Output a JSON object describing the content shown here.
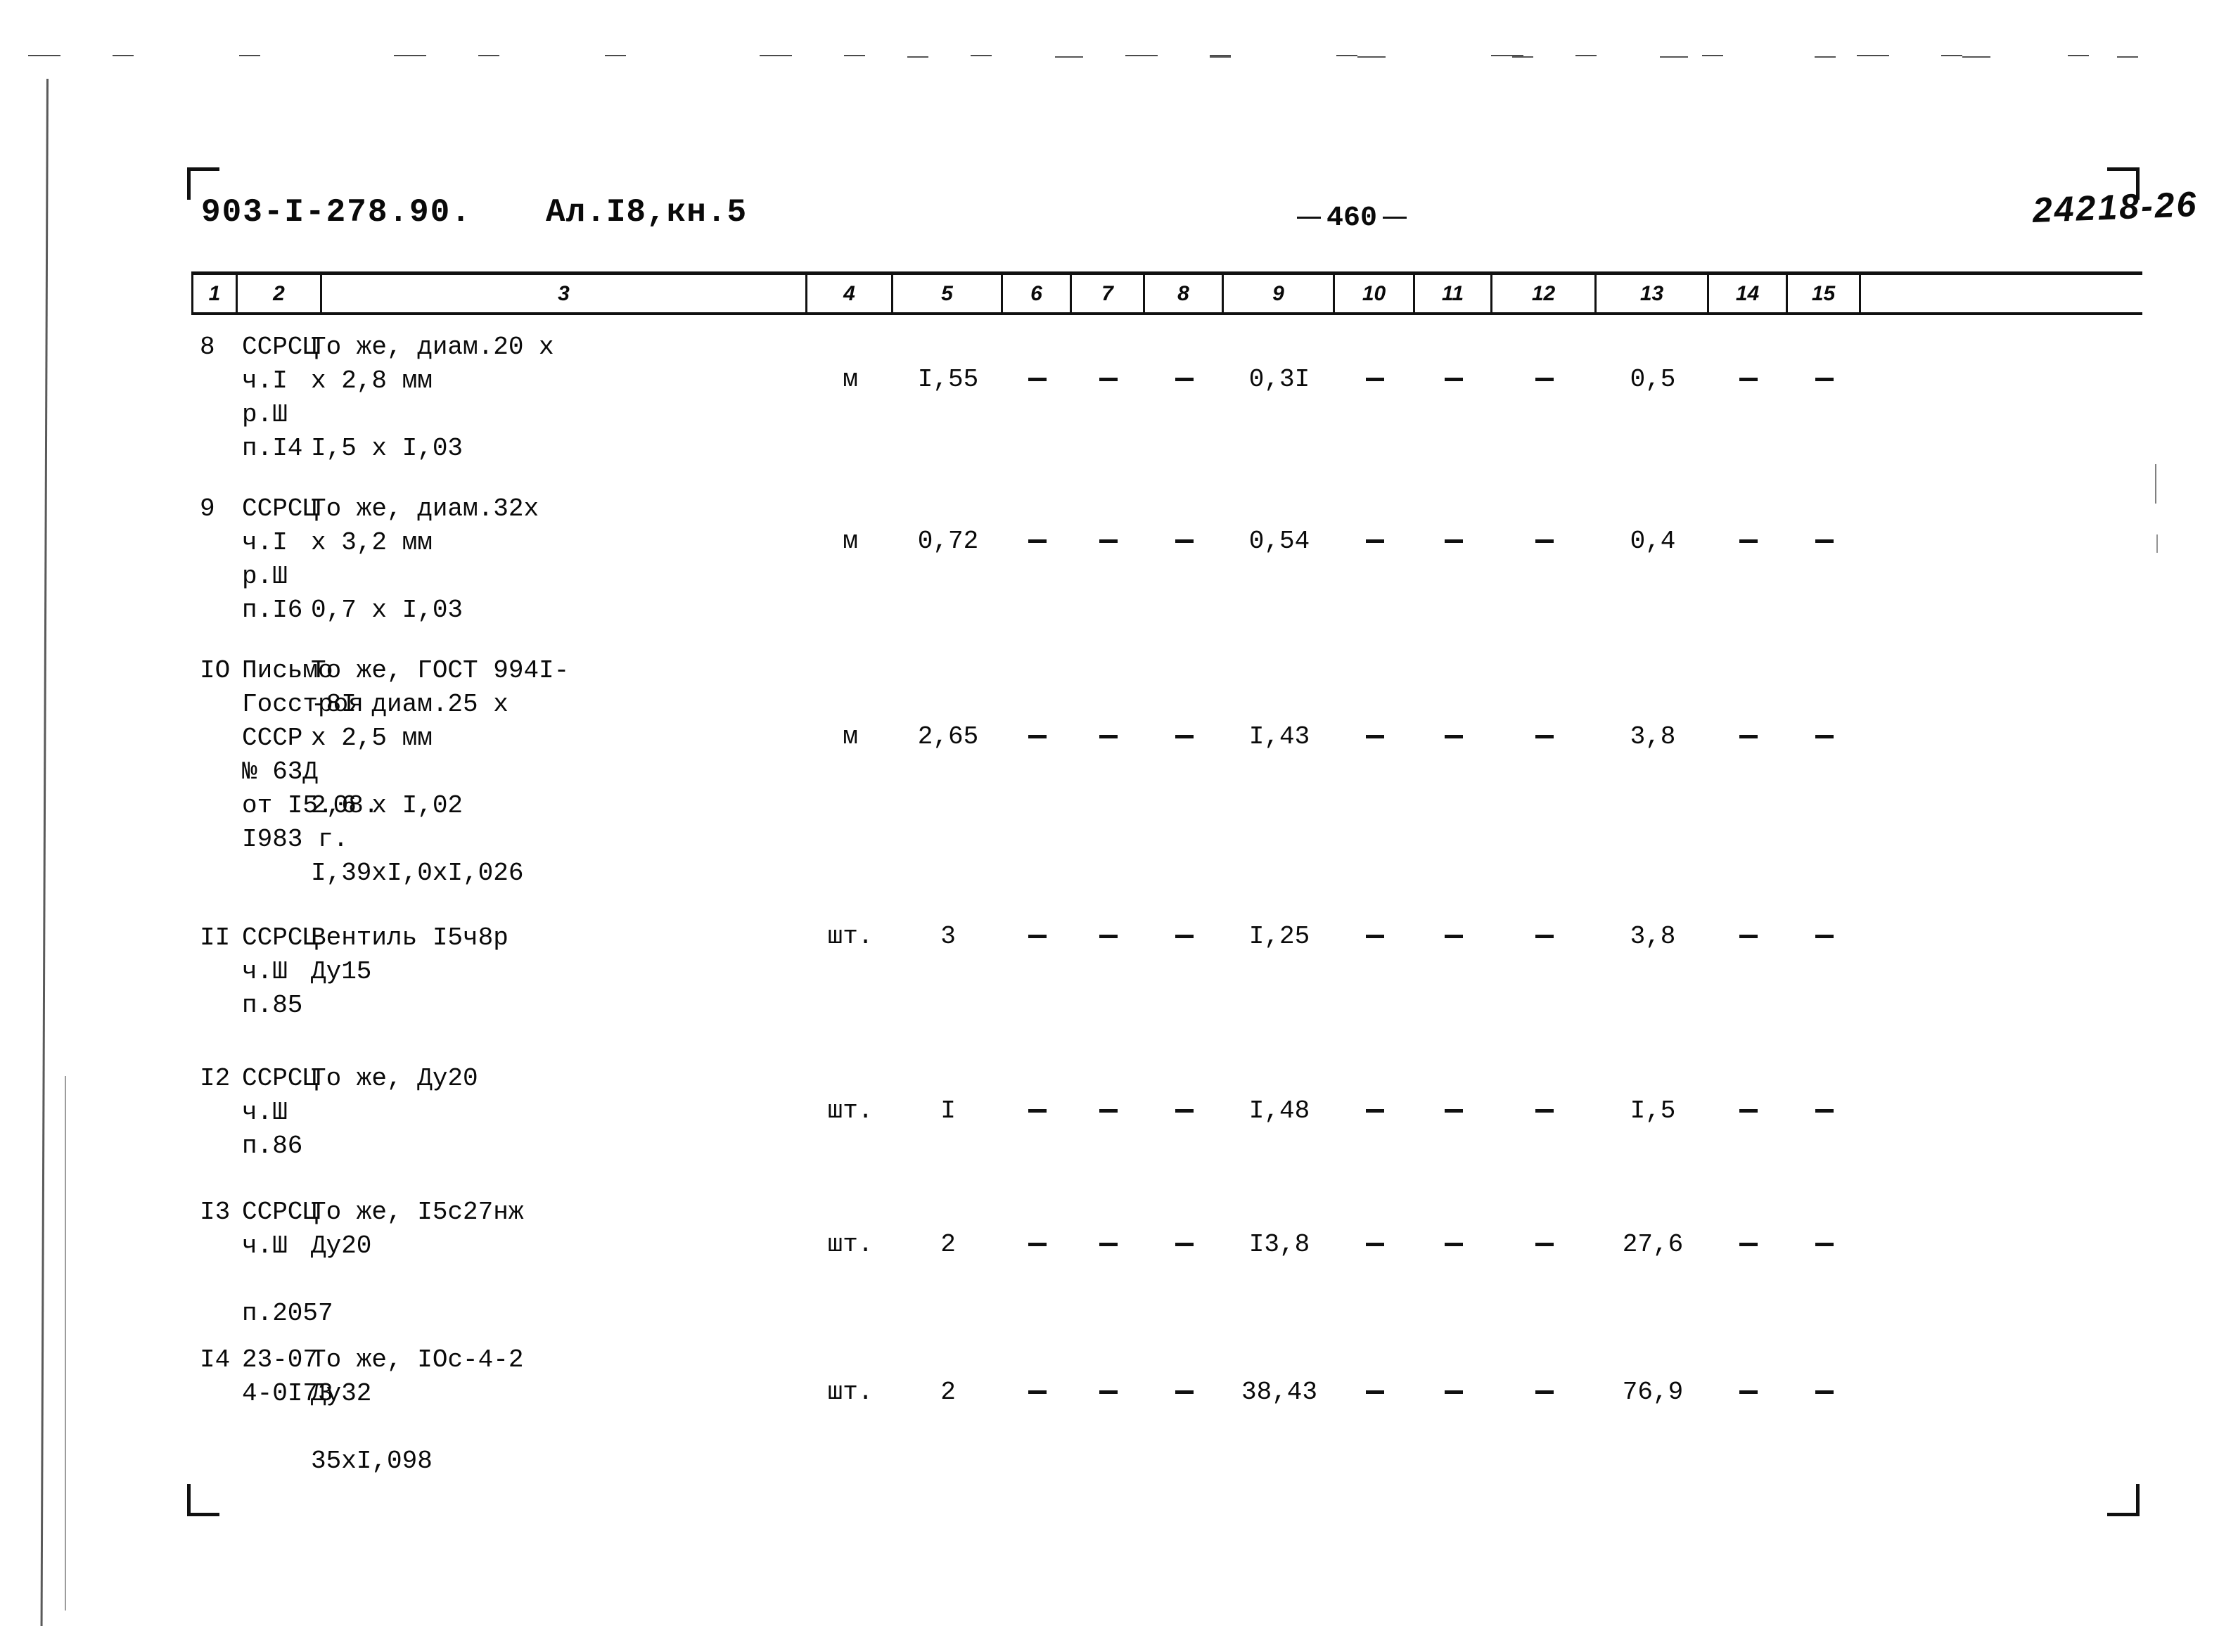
{
  "header": {
    "doc_code": "903-I-278.90.",
    "album": "Ал.I8,кн.5",
    "page_number": "460",
    "archive_stamp": "24218-26"
  },
  "table": {
    "column_numbers": [
      "1",
      "2",
      "3",
      "4",
      "5",
      "6",
      "7",
      "8",
      "9",
      "10",
      "11",
      "12",
      "13",
      "14",
      "15"
    ],
    "rows": [
      {
        "num": "8",
        "source_lines": [
          "ССРСЦ",
          "ч.I",
          "р.Ш",
          "п.I4"
        ],
        "desc_lines": [
          "То же, диам.20 х",
          "х 2,8 мм",
          "",
          "I,5 х I,03"
        ],
        "unit": "м",
        "qty": "I,55",
        "c6": "-",
        "c7": "-",
        "c8": "-",
        "c9": "0,3I",
        "c10": "-",
        "c11": "-",
        "c12": "-",
        "c13": "0,5",
        "c14": "-",
        "c15": "-"
      },
      {
        "num": "9",
        "source_lines": [
          "ССРСЦ",
          "ч.I",
          "р.Ш",
          "п.I6"
        ],
        "desc_lines": [
          "То же, диам.32х",
          "х 3,2 мм",
          "",
          "0,7 х I,03"
        ],
        "unit": "м",
        "qty": "0,72",
        "c6": "-",
        "c7": "-",
        "c8": "-",
        "c9": "0,54",
        "c10": "-",
        "c11": "-",
        "c12": "-",
        "c13": "0,4",
        "c14": "-",
        "c15": "-"
      },
      {
        "num": "IO",
        "source_lines": [
          "Письмо",
          "Госстроя",
          "СССР",
          "№ 63Д",
          "от I5.08.",
          "I983 г."
        ],
        "desc_lines": [
          "То же, ГОСТ 994I-",
          "-8I диам.25 х",
          "х 2,5 мм",
          "",
          "2,6 х I,02",
          "",
          "I,39хI,0хI,026"
        ],
        "unit": "м",
        "qty": "2,65",
        "c6": "-",
        "c7": "-",
        "c8": "-",
        "c9": "I,43",
        "c10": "-",
        "c11": "-",
        "c12": "-",
        "c13": "3,8",
        "c14": "-",
        "c15": "-"
      },
      {
        "num": "II",
        "source_lines": [
          "ССРСЦ",
          "ч.Ш",
          "п.85"
        ],
        "desc_lines": [
          "Вентиль I5ч8р",
          "Ду15"
        ],
        "unit": "шт.",
        "qty": "3",
        "c6": "-",
        "c7": "-",
        "c8": "-",
        "c9": "I,25",
        "c10": "-",
        "c11": "-",
        "c12": "-",
        "c13": "3,8",
        "c14": "-",
        "c15": "-"
      },
      {
        "num": "I2",
        "source_lines": [
          "ССРСЦ",
          "ч.Ш",
          "п.86"
        ],
        "desc_lines": [
          "То же, Ду20"
        ],
        "unit": "шт.",
        "qty": "I",
        "c6": "-",
        "c7": "-",
        "c8": "-",
        "c9": "I,48",
        "c10": "-",
        "c11": "-",
        "c12": "-",
        "c13": "I,5",
        "c14": "-",
        "c15": "-"
      },
      {
        "num": "I3",
        "source_lines": [
          "ССРСЦ",
          "ч.Ш",
          "",
          "п.2057"
        ],
        "desc_lines": [
          "То же, I5с27нж",
          "Ду20"
        ],
        "unit": "шт.",
        "qty": "2",
        "c6": "-",
        "c7": "-",
        "c8": "-",
        "c9": "I3,8",
        "c10": "-",
        "c11": "-",
        "c12": "-",
        "c13": "27,6",
        "c14": "-",
        "c15": "-"
      },
      {
        "num": "I4",
        "source_lines": [
          "23-07",
          "4-0I73"
        ],
        "desc_lines": [
          "То же, IОс-4-2",
          "Ду32",
          "",
          "35хI,098"
        ],
        "unit": "шт.",
        "qty": "2",
        "c6": "-",
        "c7": "-",
        "c8": "-",
        "c9": "38,43",
        "c10": "-",
        "c11": "-",
        "c12": "-",
        "c13": "76,9",
        "c14": "-",
        "c15": "-"
      }
    ]
  }
}
